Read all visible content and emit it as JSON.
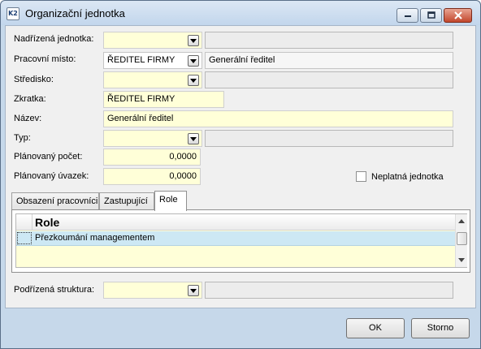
{
  "window": {
    "title": "Organizační jednotka",
    "app_icon_text": "K2"
  },
  "form": {
    "nadrizena": {
      "label": "Nadřízená jednotka:",
      "value": "",
      "name": ""
    },
    "pracovni_misto": {
      "label": "Pracovní místo:",
      "value": "ŘEDITEL FIRMY",
      "name": "Generální ředitel"
    },
    "stredisko": {
      "label": "Středisko:",
      "value": "",
      "name": ""
    },
    "zkratka": {
      "label": "Zkratka:",
      "value": "ŘEDITEL FIRMY"
    },
    "nazev": {
      "label": "Název:",
      "value": "Generální ředitel"
    },
    "typ": {
      "label": "Typ:",
      "value": "",
      "name": ""
    },
    "planovany_pocet": {
      "label": "Plánovaný počet:",
      "value": "0,0000"
    },
    "planovany_uvazek": {
      "label": "Plánovaný úvazek:",
      "value": "0,0000"
    },
    "neplatna": {
      "label": "Neplatná jednotka",
      "checked": false
    }
  },
  "tabs": [
    {
      "label": "Obsazení pracovníci",
      "active": false
    },
    {
      "label": "Zastupující",
      "active": false
    },
    {
      "label": "Role",
      "active": true
    }
  ],
  "role_grid": {
    "column": "Role",
    "rows": [
      "Přezkoumání managementem"
    ]
  },
  "podrizena": {
    "label": "Podřízená struktura:",
    "value": "",
    "name": ""
  },
  "buttons": {
    "ok": "OK",
    "cancel": "Storno"
  },
  "colors": {
    "required_field": "#ffffd8",
    "readonly_field": "#ececec",
    "selected_row": "#cde8f4",
    "window_frame": "#c6d8ea"
  }
}
